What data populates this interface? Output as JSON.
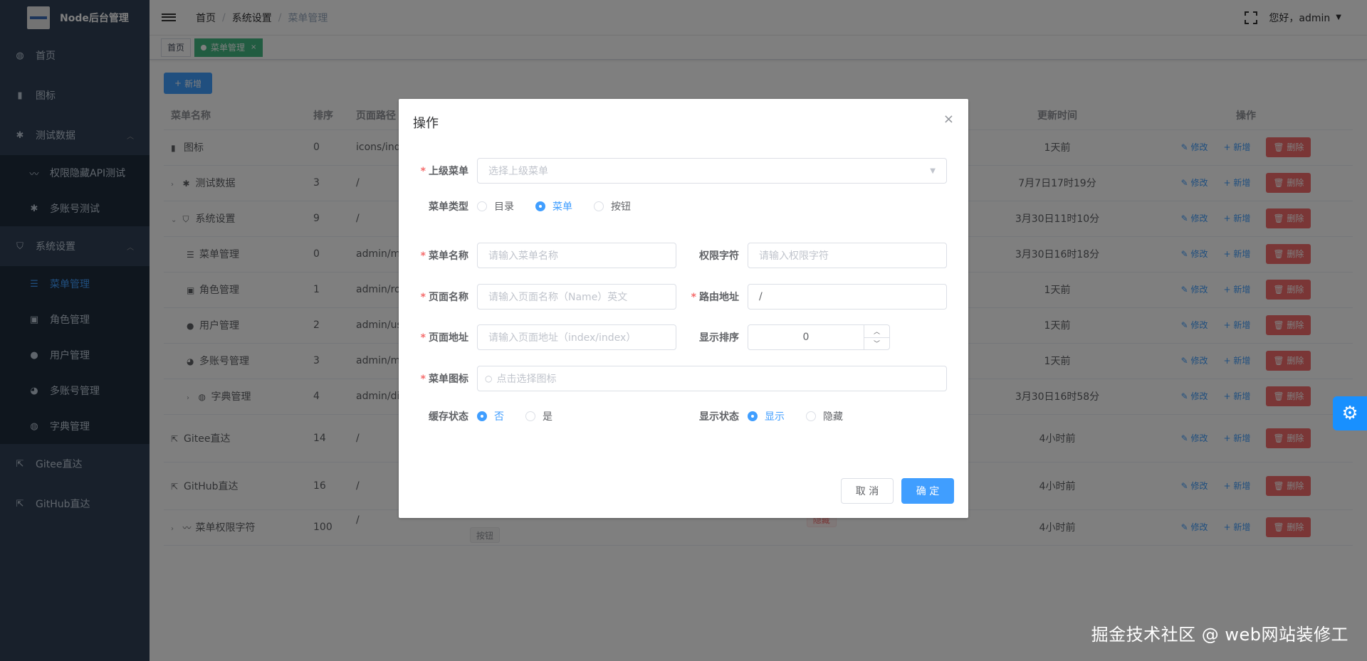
{
  "app": {
    "title": "Node后台管理"
  },
  "sidebar": {
    "items": [
      {
        "label": "首页",
        "icon": "dashboard-icon"
      },
      {
        "label": "图标",
        "icon": "info-icon"
      },
      {
        "label": "测试数据",
        "icon": "bug-icon"
      },
      {
        "label": "权限隐藏API测试",
        "icon": "eye-icon"
      },
      {
        "label": "多账号测试",
        "icon": "bug-icon"
      },
      {
        "label": "系统设置",
        "icon": "shield-icon"
      },
      {
        "label": "菜单管理",
        "icon": "list-icon"
      },
      {
        "label": "角色管理",
        "icon": "role-icon"
      },
      {
        "label": "用户管理",
        "icon": "user-icon"
      },
      {
        "label": "多账号管理",
        "icon": "peoples-icon"
      },
      {
        "label": "字典管理",
        "icon": "dashboard-icon"
      },
      {
        "label": "Gitee直达",
        "icon": "external-link-icon"
      },
      {
        "label": "GitHub直达",
        "icon": "external-link-icon"
      }
    ]
  },
  "navbar": {
    "breadcrumb": [
      "首页",
      "系统设置",
      "菜单管理"
    ],
    "breadcrumb_sep": "/",
    "greeting": "您好，admin"
  },
  "tags": {
    "home": "首页",
    "active": "菜单管理"
  },
  "toolbar": {
    "add_label": "新增",
    "add_plus": "+"
  },
  "table": {
    "headers": [
      "菜单名称",
      "排序",
      "页面路径",
      "更新时间",
      "操作"
    ],
    "rows": [
      {
        "name": "图标",
        "sort": "0",
        "path": "icons/inde",
        "updated": "1天前"
      },
      {
        "name": "测试数据",
        "sort": "3",
        "path": "/",
        "updated": "7月7日17时19分"
      },
      {
        "name": "系统设置",
        "sort": "9",
        "path": "/",
        "updated": "3月30日11时10分"
      },
      {
        "name": "菜单管理",
        "sort": "0",
        "path": "admin/me",
        "updated": "3月30日16时18分"
      },
      {
        "name": "角色管理",
        "sort": "1",
        "path": "admin/rol",
        "updated": "1天前"
      },
      {
        "name": "用户管理",
        "sort": "2",
        "path": "admin/us",
        "updated": "1天前"
      },
      {
        "name": "多账号管理",
        "sort": "3",
        "path": "admin/mo",
        "updated": "1天前"
      },
      {
        "name": "字典管理",
        "sort": "4",
        "path": "admin/dic",
        "updated": "3月30日16时58分"
      },
      {
        "name": "Gitee直达",
        "sort": "14",
        "path": "/",
        "updated": "4小时前"
      },
      {
        "name": "GitHub直达",
        "sort": "16",
        "path": "/",
        "updated": "4小时前"
      },
      {
        "name": "菜单权限字符",
        "sort": "100",
        "path": "/",
        "updated": "4小时前",
        "status": "隐藏",
        "type": "按钮"
      }
    ],
    "edit_label": "修改",
    "add_label": "新增",
    "delete_label": "删除"
  },
  "dialog": {
    "title": "操作",
    "close": "×",
    "parent_label": "上级菜单",
    "parent_placeholder": "选择上级菜单",
    "type_label": "菜单类型",
    "type_options": [
      "目录",
      "菜单",
      "按钮"
    ],
    "type_selected": "菜单",
    "name_label": "菜单名称",
    "name_placeholder": "请输入菜单名称",
    "perm_label": "权限字符",
    "perm_placeholder": "请输入权限字符",
    "page_name_label": "页面名称",
    "page_name_placeholder": "请输入页面名称（Name）英文",
    "route_label": "路由地址",
    "route_value": "/",
    "page_path_label": "页面地址",
    "page_path_placeholder": "请输入页面地址（index/index）",
    "sort_label": "显示排序",
    "sort_value": "0",
    "icon_label": "菜单图标",
    "icon_placeholder": "点击选择图标",
    "cache_label": "缓存状态",
    "cache_options": [
      "否",
      "是"
    ],
    "cache_selected": "否",
    "visible_label": "显示状态",
    "visible_options": [
      "显示",
      "隐藏"
    ],
    "visible_selected": "显示",
    "cancel_label": "取 消",
    "ok_label": "确 定",
    "required_mark": "*"
  },
  "watermark": "掘金技术社区 @ web网站装修工",
  "colors": {
    "sidebar": "#304156",
    "primary": "#409eff",
    "danger": "#f56c6c"
  }
}
